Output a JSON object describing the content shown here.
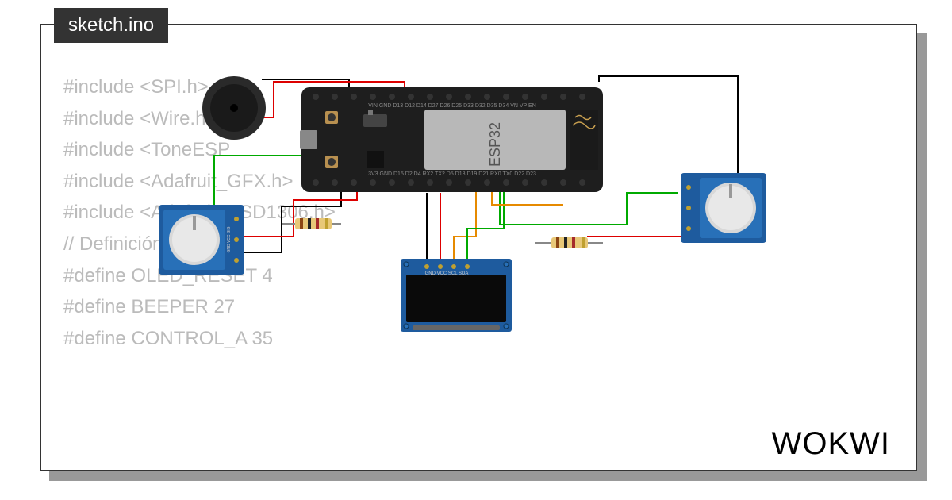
{
  "tab": {
    "label": "sketch.ino"
  },
  "code": {
    "lines": [
      "#include <SPI.h>",
      "#include <Wire.h>",
      "#include <ToneESP",
      "#include <Adafruit_GFX.h>",
      "#include <Adafruit_SSD1306.h>",
      "",
      "// Definición de",
      "#define OLED_RESET 4",
      "#define BEEPER 27",
      "#define CONTROL_A 35"
    ]
  },
  "brand": "WOKWI",
  "components": {
    "esp32_label": "ESP32",
    "esp32_top_pins": "VIN  GND  D13  D12  D14  D27  D26  D25  D33  D32  D35  D34  VN  VP  EN",
    "esp32_bottom_pins": "3V3 GND D15  D2  D4  RX2  TX2  D5  D18  D19  D21  RX0  TX0  D22  D23",
    "oled_pins": "GND VCC SCL SDA",
    "pot_pins": "GND VCC SIG"
  }
}
